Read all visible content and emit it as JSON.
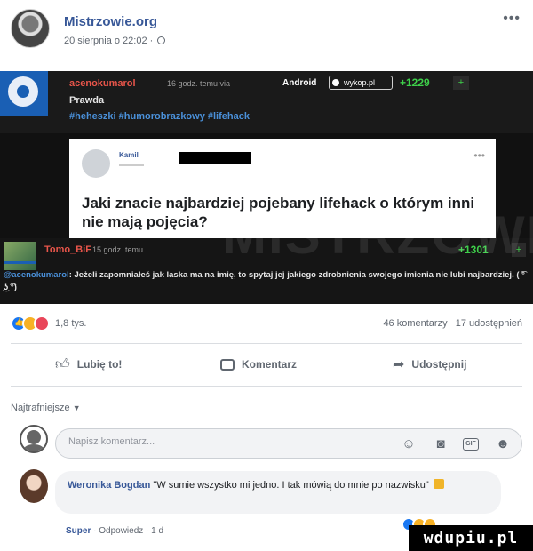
{
  "post": {
    "page_name": "Mistrzowie.org",
    "date": "20 sierpnia o 22:02 ·"
  },
  "image": {
    "comment1": {
      "user": "acenokumarol",
      "meta": "16 godz. temu via",
      "app": "Android",
      "badge": "wykop.pl",
      "score": "+1229",
      "plus": "+",
      "text": "Prawda",
      "tags": "#heheszki #humorobrazkowy #lifehack"
    },
    "quote": {
      "author": "Kamil",
      "text": "Jaki znacie najbardziej pojebany lifehack o którym inni nie mają pojęcia?"
    },
    "watermark": "MISTRZOWIE",
    "comment2": {
      "user": "Tomo_BiF",
      "meta": "15 godz. temu",
      "score": "+1301",
      "plus": "+",
      "mention": "@acenokumarol",
      "text": ": Jeżeli zapomniałeś jak laska ma na imię, to spytaj jej jakiego zdrobnienia swojego imienia nie lubi najbardziej. ( ͡° ͜ʖ ͡°)"
    }
  },
  "stats": {
    "reactions_count": "1,8 tys.",
    "comments_count": "46 komentarzy",
    "shares_count": "17 udostępnień"
  },
  "actions": {
    "like": "Lubię to!",
    "comment": "Komentarz",
    "share": "Udostępnij"
  },
  "sort": {
    "label": "Najtrafniejsze"
  },
  "composer": {
    "placeholder": "Napisz komentarz..."
  },
  "top_comment": {
    "author": "Weronika Bogdan",
    "text": "\"W sumie wszystko mi jedno. I tak mówią do mnie po nazwisku\"",
    "super": "Super",
    "reply": "Odpowiedz",
    "time": "1 d"
  },
  "site_watermark": "wdupiu.pl",
  "colors": {
    "link_blue": "#385898",
    "wykop_red": "#e8554a",
    "score_green": "#3ecf4a",
    "like_blue": "#1877f2"
  }
}
